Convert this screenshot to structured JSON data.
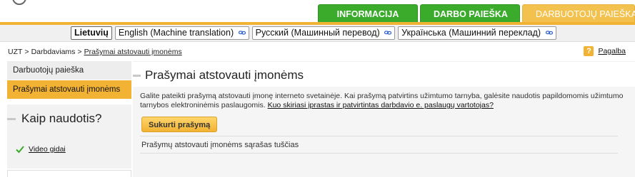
{
  "colors": {
    "accent_orange": "#f2b233",
    "tab_green": "#3aab2a"
  },
  "main_tabs": [
    {
      "label": "INFORMACIJA"
    },
    {
      "label": "DARBO PAIEŠKA"
    },
    {
      "label": "DARBUOTOJŲ PAIEŠKA"
    }
  ],
  "languages": [
    {
      "label": "Lietuvių"
    },
    {
      "label": "English (Machine translation)",
      "icon": "link-icon"
    },
    {
      "label": "Русский (Машинный перевод)",
      "icon": "link-icon"
    },
    {
      "label": "Українська (Машинний переклад)",
      "icon": "link-icon"
    }
  ],
  "breadcrumb": {
    "home": "UZT",
    "sep": ">",
    "section": "Darbdaviams",
    "current": "Prašymai atstovauti įmonėms"
  },
  "help": {
    "icon_text": "?",
    "label": "Pagalba"
  },
  "sidebar": {
    "items": [
      {
        "label": "Darbuotojų paieška"
      },
      {
        "label": "Prašymai atstovauti įmonėms"
      }
    ],
    "howto_title": "Kaip naudotis?",
    "video_label": "Video gidai"
  },
  "main": {
    "title": "Prašymai atstovauti įmonėms",
    "description": "Galite pateikti prašymą atstovauti įmonę interneto svetainėje. Kai prašymą patvirtins užimtumo tarnyba, galėsite naudotis papildomomis užimtumo tarnybos elektroninėmis paslaugomis.",
    "description_link": "Kuo skiriasi įprastas ir patvirtintas darbdavio e. paslaugų vartotojas?",
    "create_button": "Sukurti prašymą",
    "empty_list": "Prašymų atstovauti įmonėms sąrašas tuščias"
  }
}
